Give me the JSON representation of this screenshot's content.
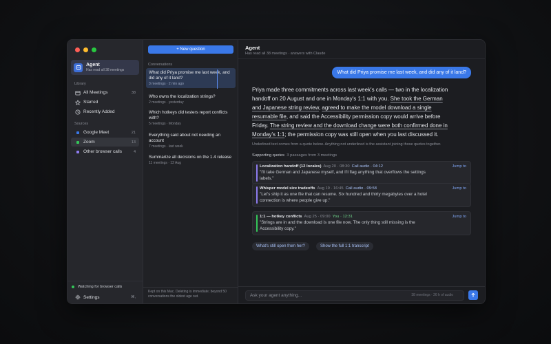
{
  "sidebar": {
    "agent": {
      "name": "Agent",
      "subtitle": "Has read all 38 meetings"
    },
    "library_label": "Library",
    "library": [
      {
        "label": "All Meetings",
        "count": "38",
        "icon": "calendar-icon"
      },
      {
        "label": "Starred",
        "count": "",
        "icon": "star-icon"
      },
      {
        "label": "Recently Added",
        "count": "",
        "icon": "clock-icon"
      }
    ],
    "sources_label": "Sources",
    "sources": [
      {
        "label": "Google Meet",
        "count": "21",
        "color": "#3a78e8"
      },
      {
        "label": "Zoom",
        "count": "13",
        "color": "#34c759"
      },
      {
        "label": "Other browser calls",
        "count": "4",
        "color": "#8e7cf0"
      }
    ],
    "watching": "Watching for browser calls",
    "settings": {
      "label": "Settings",
      "shortcut": "⌘,"
    }
  },
  "conversations": {
    "new_button": "+ New question",
    "label": "Conversations",
    "items": [
      {
        "title": "What did Priya promise me last week, and did any of it land?",
        "meta": "3 meetings · 2 min ago"
      },
      {
        "title": "Who owns the localization strings?",
        "meta": "2 meetings · yesterday"
      },
      {
        "title": "Which hotkeys did testers report conflicts with?",
        "meta": "5 meetings · Monday"
      },
      {
        "title": "Everything said about not needing an account",
        "meta": "7 meetings · last week"
      },
      {
        "title": "Summarize all decisions on the 1.4 release",
        "meta": "11 meetings · 12 Aug"
      }
    ],
    "footer": "Kept on this Mac. Deleting is immediate; beyond 50 conversations the oldest age out."
  },
  "main": {
    "title": "Agent",
    "subtitle": "Has read all 38 meetings · answers with Claude",
    "user_message": "What did Priya promise me last week, and did any of it land?",
    "answer": {
      "p1": "Priya made three commitments across last week's calls — two in the localization handoff on 20 August and one in Monday's 1:1 with you. ",
      "u1": "She took the German and Japanese string review",
      "p2": ", ",
      "u2": "agreed to make the model download a single resumable file",
      "p3": ", and said the Accessibility permission copy would arrive before Friday. ",
      "u3": "The string review and the download change were both confirmed done in Monday's 1:1",
      "p4": "; the permission copy was still open when you last discussed it."
    },
    "note": "Underlined text comes from a quote below. Anything not underlined is the assistant joining those quotes together.",
    "supporting_label": "Supporting quotes",
    "supporting_meta": "3 passages from 3 meetings",
    "quotes": [
      {
        "title": "Localization handoff (12 locales)",
        "time": "Aug 20 · 08:30",
        "source": "Call audio · 04:12",
        "text": "\"I'll take German and Japanese myself, and I'll flag anything that overflows the settings labels.\"",
        "jump": "Jump to",
        "bar": "#8e7cf0",
        "src_color": "#a9c2f7"
      },
      {
        "title": "Whisper model size tradeoffs",
        "time": "Aug 19 · 16:45",
        "source": "Call audio · 09:58",
        "text": "\"Let's ship it as one file that can resume. Six hundred and thirty megabytes over a hotel connection is where people give up.\"",
        "jump": "Jump to",
        "bar": "#8e7cf0",
        "src_color": "#a9c2f7"
      },
      {
        "title": "1:1 — hotkey conflicts",
        "time": "Aug 25 · 09:00",
        "source": "You · 12:31",
        "text": "\"Strings are in and the download is one file now. The only thing still missing is the Accessibility copy.\"",
        "jump": "Jump to",
        "bar": "#34c759",
        "src_color": "#6fd68a"
      }
    ],
    "chips": [
      "What's still open from her?",
      "Show the full 1:1 transcript"
    ],
    "input": {
      "placeholder": "Ask your agent anything...",
      "stats": "38 meetings · 26 h of audio"
    }
  }
}
